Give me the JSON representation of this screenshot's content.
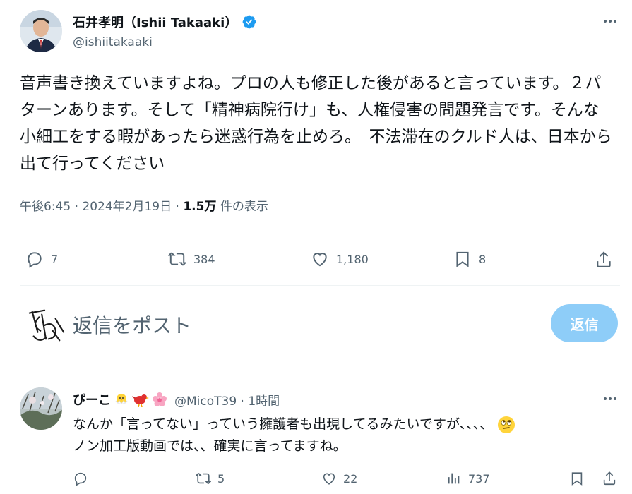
{
  "tweet": {
    "author_name": "石井孝明（Ishii Takaaki）",
    "handle": "@ishiitakaaki",
    "text": "音声書き換えていますよね。プロの人も修正した後があると言っています。２パターンあります。そして「精神病院行け」も、人権侵害の問題発言です。そんな小細工をする暇があったら迷惑行為を止めろ。　不法滞在のクルド人は、日本から出て行ってください",
    "time": "午後6:45 · 2024年2月19日 · ",
    "views_count": "1.5万",
    "views_label": " 件の表示",
    "actions": {
      "replies": "7",
      "reposts": "384",
      "likes": "1,180",
      "bookmarks": "8"
    },
    "icons": [
      "verified-icon",
      "more-icon",
      "reply-icon",
      "repost-icon",
      "like-icon",
      "bookmark-icon",
      "share-icon"
    ]
  },
  "composer": {
    "placeholder": "返信をポスト",
    "button_label": "返信"
  },
  "reply": {
    "author_name": "ぴーこ",
    "handle": "@MicoT39 · 1時間",
    "text_line1": "なんか「言ってない」っていう擁護者も出現してるみたいですが、、、、",
    "text_line2": "ノン加工版動画では、、確実に言ってますね。",
    "actions": {
      "replies": "",
      "reposts": "5",
      "likes": "22",
      "views": "737"
    },
    "icons": [
      "chick-emoji",
      "bird-emoji",
      "cherry-blossom-emoji",
      "eye-roll-emoji",
      "views-icon"
    ]
  },
  "colors": {
    "accent": "#1d9bf0",
    "reply_button_disabled": "#8ecdf8",
    "muted": "#536471",
    "text": "#0f1419"
  }
}
